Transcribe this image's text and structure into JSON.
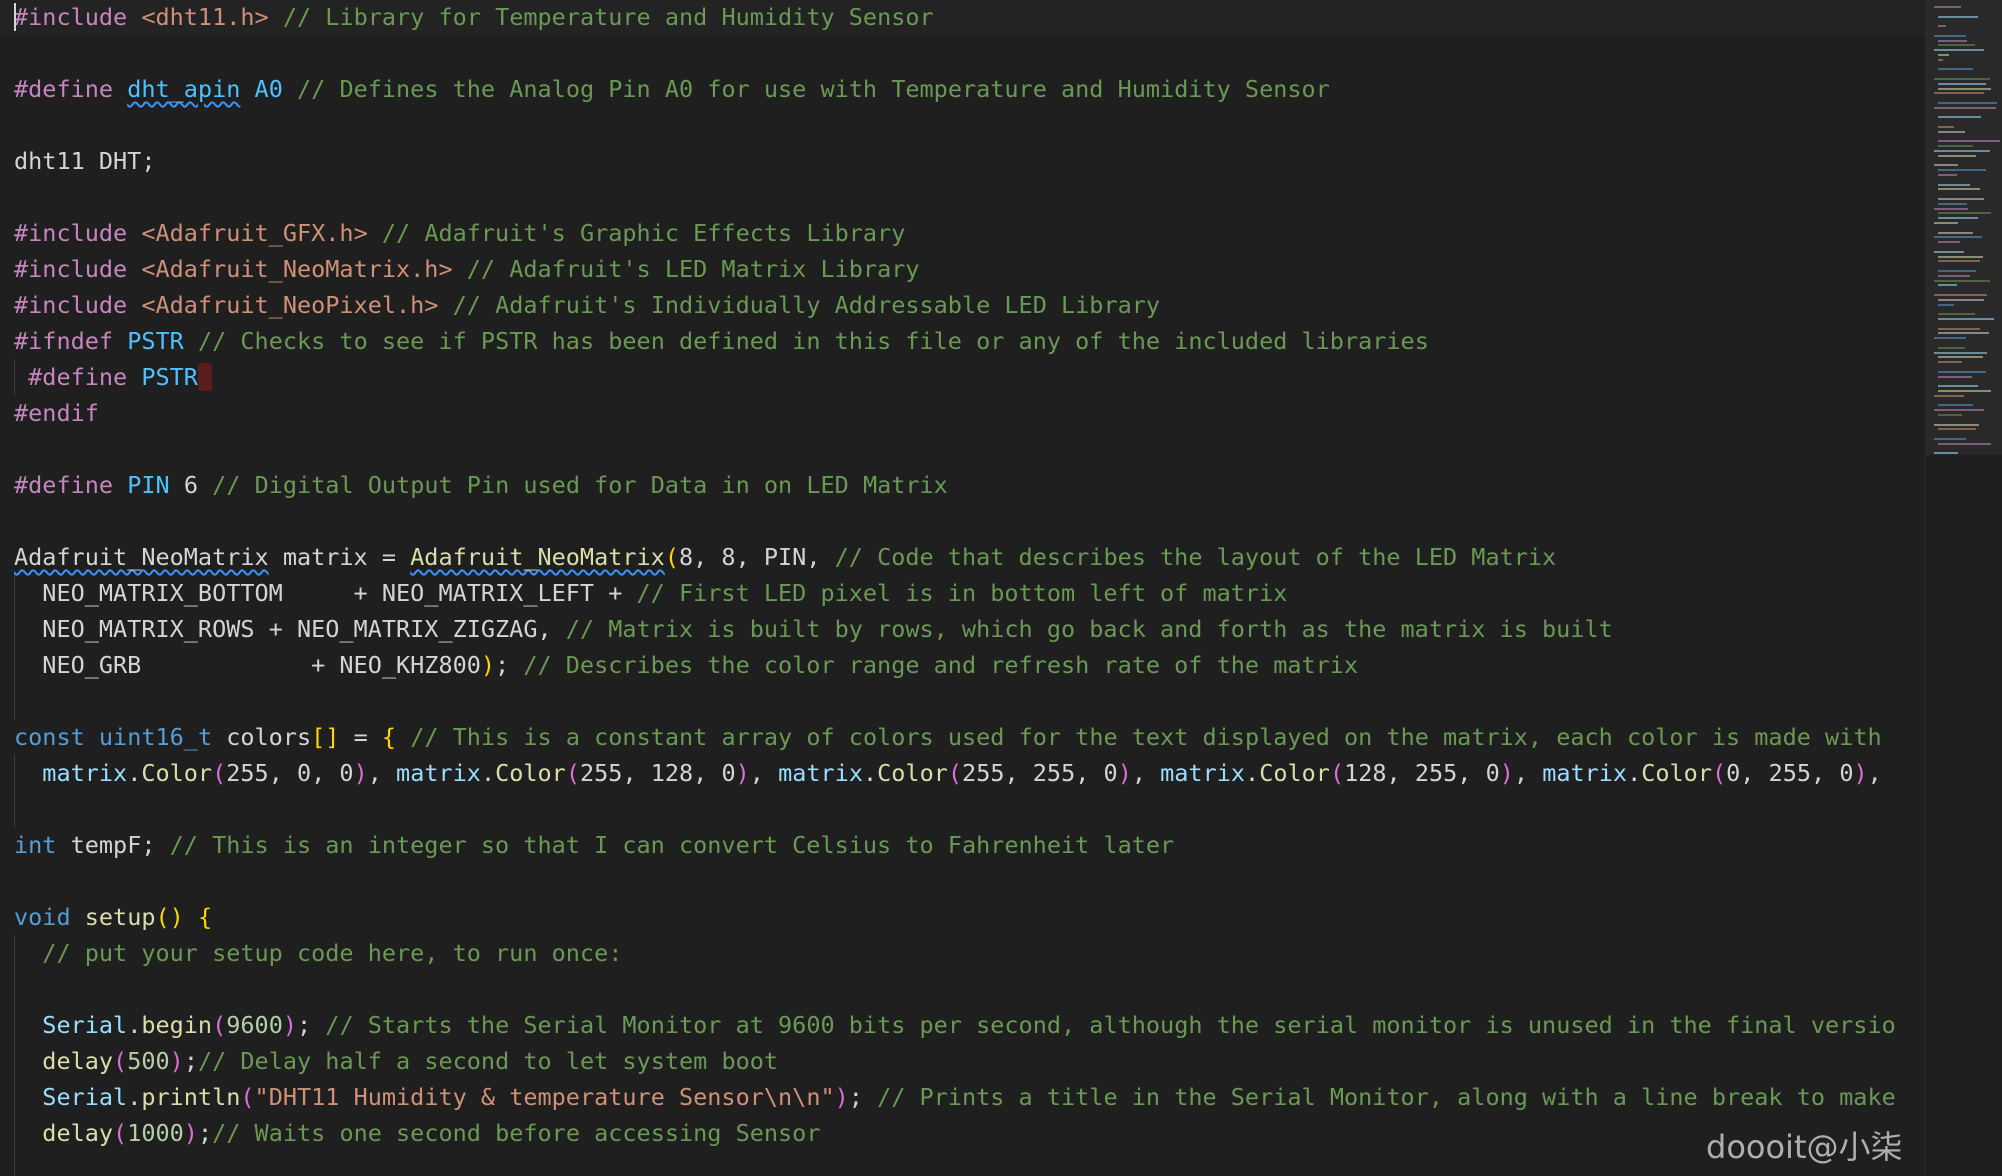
{
  "editor": {
    "language": "C++ (Arduino)",
    "theme_colors": {
      "background": "#1f1f1f",
      "preprocessor": "#c586c0",
      "string": "#ce9178",
      "comment": "#6a9955",
      "identifier": "#9cdcfe",
      "keyword": "#569cd6",
      "function": "#dcdcaa",
      "number": "#b5cea8"
    },
    "lines": [
      [
        {
          "t": "#include",
          "c": "pp"
        },
        {
          "t": " "
        },
        {
          "t": "<dht11.h>",
          "c": "str"
        },
        {
          "t": " "
        },
        {
          "t": "// Library for Temperature and Humidity Sensor",
          "c": "com"
        }
      ],
      [],
      [
        {
          "t": "#define",
          "c": "pp"
        },
        {
          "t": " "
        },
        {
          "t": "dht_apin",
          "c": "macro",
          "sq": true
        },
        {
          "t": " "
        },
        {
          "t": "A0",
          "c": "macro"
        },
        {
          "t": " "
        },
        {
          "t": "// Defines the Analog Pin A0 for use with Temperature and Humidity Sensor",
          "c": "com"
        }
      ],
      [],
      [
        {
          "t": "dht11 DHT;",
          "c": "plain"
        }
      ],
      [],
      [
        {
          "t": "#include",
          "c": "pp"
        },
        {
          "t": " "
        },
        {
          "t": "<Adafruit_GFX.h>",
          "c": "str"
        },
        {
          "t": " "
        },
        {
          "t": "// Adafruit's Graphic Effects Library",
          "c": "com"
        }
      ],
      [
        {
          "t": "#include",
          "c": "pp"
        },
        {
          "t": " "
        },
        {
          "t": "<Adafruit_NeoMatrix.h>",
          "c": "str"
        },
        {
          "t": " "
        },
        {
          "t": "// Adafruit's LED Matrix Library",
          "c": "com"
        }
      ],
      [
        {
          "t": "#include",
          "c": "pp"
        },
        {
          "t": " "
        },
        {
          "t": "<Adafruit_NeoPixel.h>",
          "c": "str"
        },
        {
          "t": " "
        },
        {
          "t": "// Adafruit's Individually Addressable LED Library",
          "c": "com"
        }
      ],
      [
        {
          "t": "#ifndef",
          "c": "pp"
        },
        {
          "t": " "
        },
        {
          "t": "PSTR",
          "c": "macro"
        },
        {
          "t": " "
        },
        {
          "t": "// Checks to see if PSTR has been defined in this file or any of the included libraries",
          "c": "com"
        }
      ],
      [
        {
          "t": " "
        },
        {
          "t": "#define",
          "c": "pp"
        },
        {
          "t": " "
        },
        {
          "t": "PSTR",
          "c": "macro"
        },
        {
          "t": " ",
          "err": true
        }
      ],
      [
        {
          "t": "#endif",
          "c": "pp"
        }
      ],
      [],
      [
        {
          "t": "#define",
          "c": "pp"
        },
        {
          "t": " "
        },
        {
          "t": "PIN",
          "c": "macro"
        },
        {
          "t": " "
        },
        {
          "t": "6",
          "c": "plain"
        },
        {
          "t": " "
        },
        {
          "t": "// Digital Output Pin used for Data in on LED Matrix",
          "c": "com"
        }
      ],
      [],
      [
        {
          "t": "Adafruit_NeoMatrix",
          "c": "plain",
          "sq": true
        },
        {
          "t": " matrix = ",
          "c": "plain"
        },
        {
          "t": "Adafruit_NeoMatrix",
          "c": "fn",
          "sq": true
        },
        {
          "t": "(",
          "c": "brk1"
        },
        {
          "t": "8, 8, PIN, ",
          "c": "plain"
        },
        {
          "t": "// Code that describes the layout of the LED Matrix",
          "c": "com"
        }
      ],
      [
        {
          "t": "  NEO_MATRIX_BOTTOM     + NEO_MATRIX_LEFT + ",
          "c": "plain"
        },
        {
          "t": "// First LED pixel is in bottom left of matrix",
          "c": "com"
        }
      ],
      [
        {
          "t": "  NEO_MATRIX_ROWS + NEO_MATRIX_ZIGZAG, ",
          "c": "plain"
        },
        {
          "t": "// Matrix is built by rows, which go back and forth as the matrix is built",
          "c": "com"
        }
      ],
      [
        {
          "t": "  NEO_GRB            + NEO_KHZ800",
          "c": "plain"
        },
        {
          "t": ")",
          "c": "brk1"
        },
        {
          "t": "; ",
          "c": "plain"
        },
        {
          "t": "// Describes the color range and refresh rate of the matrix",
          "c": "com"
        }
      ],
      [],
      [
        {
          "t": "const",
          "c": "kw"
        },
        {
          "t": " "
        },
        {
          "t": "uint16_t",
          "c": "kw"
        },
        {
          "t": " colors",
          "c": "plain"
        },
        {
          "t": "[]",
          "c": "brk1"
        },
        {
          "t": " = ",
          "c": "plain"
        },
        {
          "t": "{",
          "c": "brk1"
        },
        {
          "t": " "
        },
        {
          "t": "// This is a constant array of colors used for the text displayed on the matrix, each color is made with",
          "c": "com"
        }
      ],
      [
        {
          "t": "  "
        },
        {
          "t": "matrix",
          "c": "id"
        },
        {
          "t": ".",
          "c": "plain"
        },
        {
          "t": "Color",
          "c": "fn"
        },
        {
          "t": "(",
          "c": "brk2"
        },
        {
          "t": "255, 0, 0",
          "c": "plain"
        },
        {
          "t": ")",
          "c": "brk2"
        },
        {
          "t": ", ",
          "c": "plain"
        },
        {
          "t": "matrix",
          "c": "id"
        },
        {
          "t": ".",
          "c": "plain"
        },
        {
          "t": "Color",
          "c": "fn"
        },
        {
          "t": "(",
          "c": "brk2"
        },
        {
          "t": "255, 128, 0",
          "c": "plain"
        },
        {
          "t": ")",
          "c": "brk2"
        },
        {
          "t": ", ",
          "c": "plain"
        },
        {
          "t": "matrix",
          "c": "id"
        },
        {
          "t": ".",
          "c": "plain"
        },
        {
          "t": "Color",
          "c": "fn"
        },
        {
          "t": "(",
          "c": "brk2"
        },
        {
          "t": "255, 255, 0",
          "c": "plain"
        },
        {
          "t": ")",
          "c": "brk2"
        },
        {
          "t": ", ",
          "c": "plain"
        },
        {
          "t": "matrix",
          "c": "id"
        },
        {
          "t": ".",
          "c": "plain"
        },
        {
          "t": "Color",
          "c": "fn"
        },
        {
          "t": "(",
          "c": "brk2"
        },
        {
          "t": "128, 255, 0",
          "c": "plain"
        },
        {
          "t": ")",
          "c": "brk2"
        },
        {
          "t": ", ",
          "c": "plain"
        },
        {
          "t": "matrix",
          "c": "id"
        },
        {
          "t": ".",
          "c": "plain"
        },
        {
          "t": "Color",
          "c": "fn"
        },
        {
          "t": "(",
          "c": "brk2"
        },
        {
          "t": "0, 255, 0",
          "c": "plain"
        },
        {
          "t": ")",
          "c": "brk2"
        },
        {
          "t": ",",
          "c": "plain"
        }
      ],
      [],
      [
        {
          "t": "int",
          "c": "kw"
        },
        {
          "t": " tempF; ",
          "c": "plain"
        },
        {
          "t": "// This is an integer so that I can convert Celsius to Fahrenheit later",
          "c": "com"
        }
      ],
      [],
      [
        {
          "t": "void",
          "c": "kw"
        },
        {
          "t": " "
        },
        {
          "t": "setup",
          "c": "fn"
        },
        {
          "t": "()",
          "c": "brk1"
        },
        {
          "t": " "
        },
        {
          "t": "{",
          "c": "brk1"
        }
      ],
      [
        {
          "t": "  "
        },
        {
          "t": "// put your setup code here, to run once:",
          "c": "com"
        }
      ],
      [],
      [
        {
          "t": "  "
        },
        {
          "t": "Serial",
          "c": "id"
        },
        {
          "t": ".",
          "c": "plain"
        },
        {
          "t": "begin",
          "c": "fn"
        },
        {
          "t": "(",
          "c": "brk2"
        },
        {
          "t": "9600",
          "c": "num"
        },
        {
          "t": ")",
          "c": "brk2"
        },
        {
          "t": "; ",
          "c": "plain"
        },
        {
          "t": "// Starts the Serial Monitor at 9600 bits per second, although the serial monitor is unused in the final versio",
          "c": "com"
        }
      ],
      [
        {
          "t": "  "
        },
        {
          "t": "delay",
          "c": "fn"
        },
        {
          "t": "(",
          "c": "brk2"
        },
        {
          "t": "500",
          "c": "num"
        },
        {
          "t": ")",
          "c": "brk2"
        },
        {
          "t": ";",
          "c": "plain"
        },
        {
          "t": "// Delay half a second to let system boot",
          "c": "com"
        }
      ],
      [
        {
          "t": "  "
        },
        {
          "t": "Serial",
          "c": "id"
        },
        {
          "t": ".",
          "c": "plain"
        },
        {
          "t": "println",
          "c": "fn"
        },
        {
          "t": "(",
          "c": "brk2"
        },
        {
          "t": "\"DHT11 Humidity & temperature Sensor\\n\\n\"",
          "c": "str"
        },
        {
          "t": ")",
          "c": "brk2"
        },
        {
          "t": "; ",
          "c": "plain"
        },
        {
          "t": "// Prints a title in the Serial Monitor, along with a line break to make",
          "c": "com"
        }
      ],
      [
        {
          "t": "  "
        },
        {
          "t": "delay",
          "c": "fn"
        },
        {
          "t": "(",
          "c": "brk2"
        },
        {
          "t": "1000",
          "c": "num"
        },
        {
          "t": ")",
          "c": "brk2"
        },
        {
          "t": ";",
          "c": "plain"
        },
        {
          "t": "// Waits one second before accessing Sensor",
          "c": "com"
        }
      ],
      []
    ]
  },
  "watermark": {
    "text": "doooit@小柒"
  }
}
